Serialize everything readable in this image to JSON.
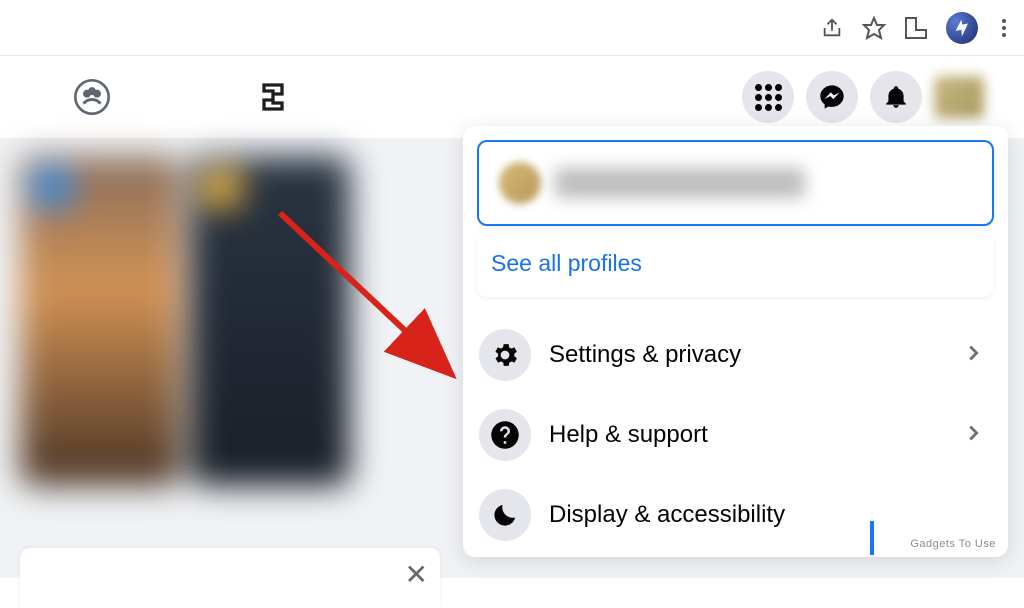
{
  "browser_chrome": {
    "share_icon": "share-icon",
    "star_icon": "star-icon",
    "extensions_icon": "extensions-icon",
    "profile_icon": "profile-avatar",
    "kebab_icon": "kebab-menu"
  },
  "fb_nav": {
    "groups_icon": "groups-icon",
    "gaming_icon": "gaming-icon",
    "menu_icon": "menu-grid-icon",
    "messenger_icon": "messenger-icon",
    "notifications_icon": "notifications-icon"
  },
  "dropdown": {
    "see_all_label": "See all profiles",
    "items": [
      {
        "label": "Settings & privacy",
        "icon": "gear-icon"
      },
      {
        "label": "Help & support",
        "icon": "question-icon"
      },
      {
        "label": "Display & accessibility",
        "icon": "moon-icon"
      }
    ]
  },
  "annotation": {
    "color": "#d8231a"
  },
  "compose": {
    "close_label": "✕"
  },
  "watermark": "Gadgets To Use"
}
